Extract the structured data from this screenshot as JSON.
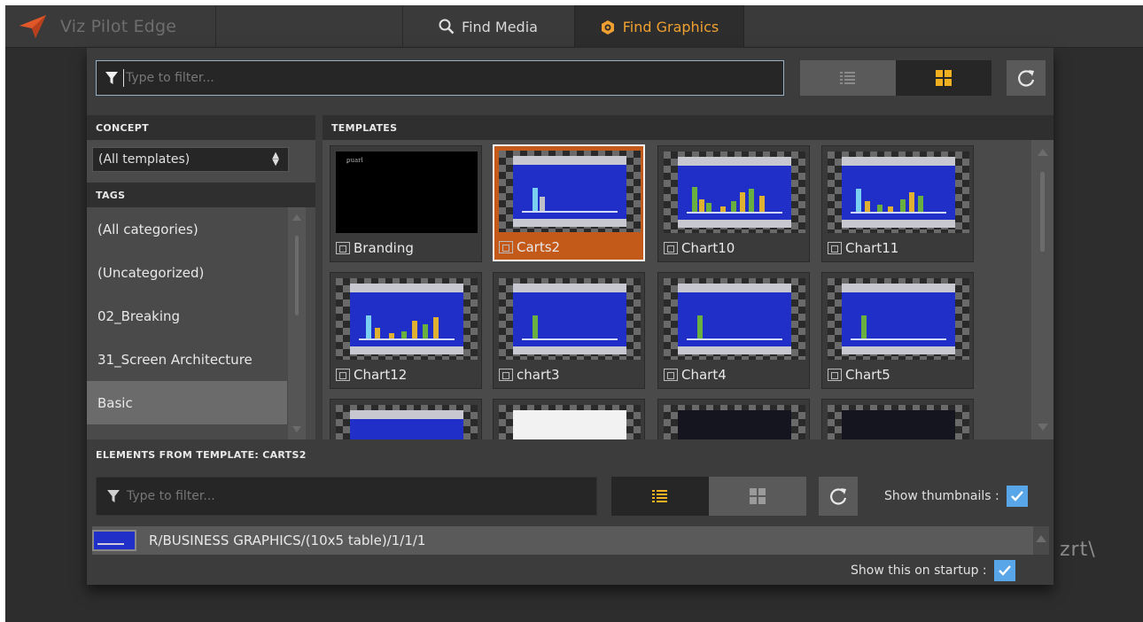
{
  "app": {
    "title": "Viz Pilot Edge",
    "logo_icon": "paper-plane-icon"
  },
  "tabs": [
    {
      "label": "Find Media",
      "icon": "search-icon"
    },
    {
      "label": "Find Graphics",
      "icon": "graphics-icon",
      "active": true
    }
  ],
  "filter": {
    "placeholder": "Type to filter..."
  },
  "view_modes": {
    "list_icon": "list-icon",
    "grid_icon": "grid-icon",
    "active": "grid"
  },
  "concept": {
    "heading": "CONCEPT",
    "selected": "(All templates)"
  },
  "tags": {
    "heading": "TAGS",
    "items": [
      "(All categories)",
      "(Uncategorized)",
      "02_Breaking",
      "31_Screen Architecture",
      "Basic"
    ],
    "selected": "Basic"
  },
  "templates": {
    "heading": "TEMPLATES",
    "items": [
      {
        "label": "Branding"
      },
      {
        "label": "Carts2",
        "selected": true
      },
      {
        "label": "Chart10"
      },
      {
        "label": "Chart11"
      },
      {
        "label": "Chart12"
      },
      {
        "label": "chart3"
      },
      {
        "label": "Chart4"
      },
      {
        "label": "Chart5"
      }
    ]
  },
  "elements": {
    "heading": "ELEMENTS FROM TEMPLATE: CARTS2",
    "filter_placeholder": "Type to filter...",
    "view_active": "list",
    "show_thumbnails_label": "Show thumbnails :",
    "show_thumbnails": true,
    "rows": [
      {
        "path": "R/BUSINESS GRAPHICS/(10x5 table)/1/1/1"
      }
    ],
    "show_on_startup_label": "Show this on startup :",
    "show_on_startup": true
  },
  "background_logo": "zrt\\",
  "colors": {
    "accent": "#f0a030",
    "selection": "#c45a1a",
    "checkbox": "#58a6e8"
  }
}
